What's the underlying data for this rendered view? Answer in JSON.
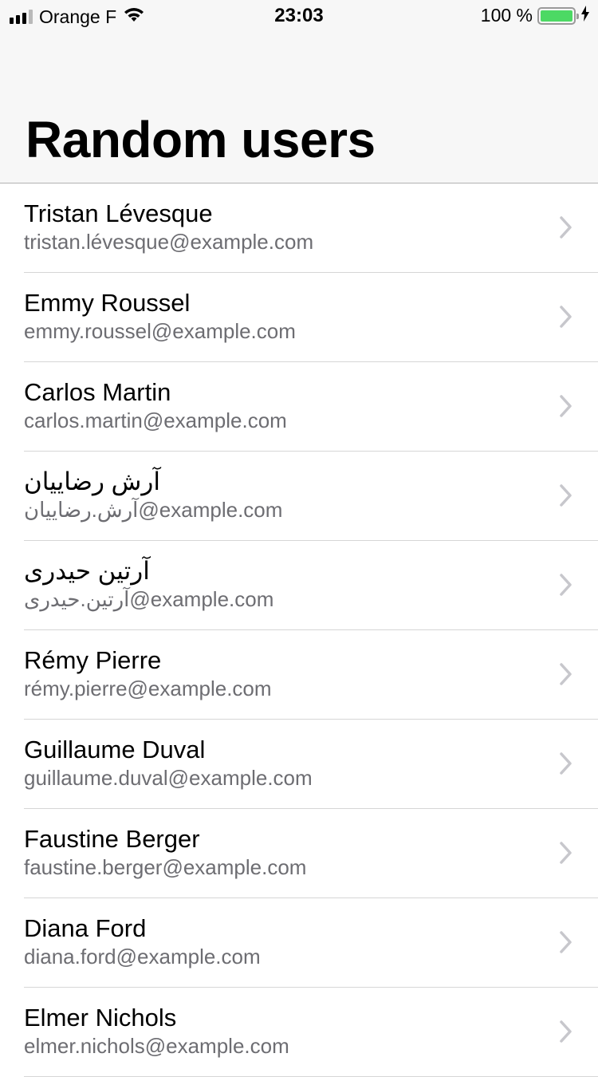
{
  "status_bar": {
    "carrier": "Orange F",
    "time": "23:03",
    "battery": "100 %",
    "signal_bars": 4,
    "signal_bars_filled": 3,
    "icons": [
      "signal-icon",
      "wifi-icon",
      "battery-icon",
      "charging-icon"
    ]
  },
  "nav": {
    "title": "Random users"
  },
  "users": [
    {
      "name": "Tristan Lévesque",
      "email": "tristan.lévesque@example.com"
    },
    {
      "name": "Emmy Roussel",
      "email": "emmy.roussel@example.com"
    },
    {
      "name": "Carlos Martin",
      "email": "carlos.martin@example.com"
    },
    {
      "name": "آرش رضاییان",
      "email": "آرش.رضاییان@example.com"
    },
    {
      "name": "آرتین حیدری",
      "email": "آرتین.حیدری@example.com"
    },
    {
      "name": "Rémy Pierre",
      "email": "rémy.pierre@example.com"
    },
    {
      "name": "Guillaume Duval",
      "email": "guillaume.duval@example.com"
    },
    {
      "name": "Faustine Berger",
      "email": "faustine.berger@example.com"
    },
    {
      "name": "Diana Ford",
      "email": "diana.ford@example.com"
    },
    {
      "name": "Elmer Nichols",
      "email": "elmer.nichols@example.com"
    }
  ],
  "colors": {
    "battery_fill": "#4cd964",
    "secondary_text": "#6d6d72",
    "chevron": "#c7c7cc",
    "bar_background": "#f7f7f7"
  }
}
